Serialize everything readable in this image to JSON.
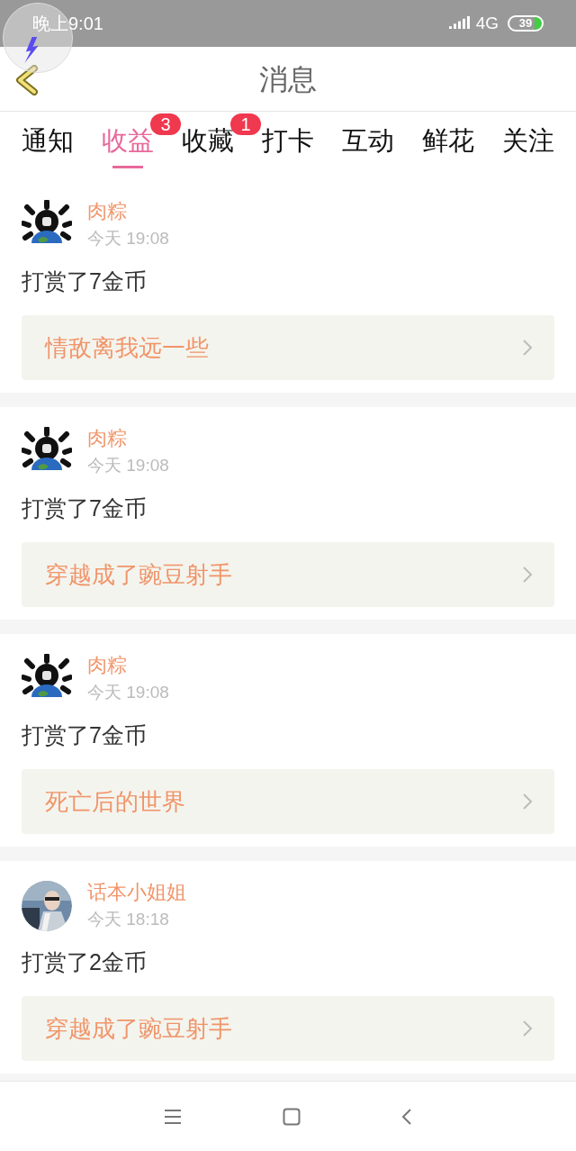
{
  "status_bar": {
    "time": "晚上9:01",
    "network": "4G",
    "battery": "39"
  },
  "header": {
    "title": "消息"
  },
  "tabs": [
    {
      "label": "通知",
      "selected": false
    },
    {
      "label": "收益",
      "selected": true,
      "badge": "3"
    },
    {
      "label": "收藏",
      "selected": false,
      "badge": "1"
    },
    {
      "label": "打卡",
      "selected": false
    },
    {
      "label": "互动",
      "selected": false
    },
    {
      "label": "鲜花",
      "selected": false
    },
    {
      "label": "关注",
      "selected": false
    }
  ],
  "messages": [
    {
      "user": "肉粽",
      "time": "今天 19:08",
      "text": "打赏了7金币",
      "book": "情敌离我远一些"
    },
    {
      "user": "肉粽",
      "time": "今天 19:08",
      "text": "打赏了7金币",
      "book": "穿越成了豌豆射手"
    },
    {
      "user": "肉粽",
      "time": "今天 19:08",
      "text": "打赏了7金币",
      "book": "死亡后的世界"
    },
    {
      "user": "话本小姐姐",
      "time": "今天 18:18",
      "text": "打赏了2金币",
      "book": "穿越成了豌豆射手"
    }
  ]
}
